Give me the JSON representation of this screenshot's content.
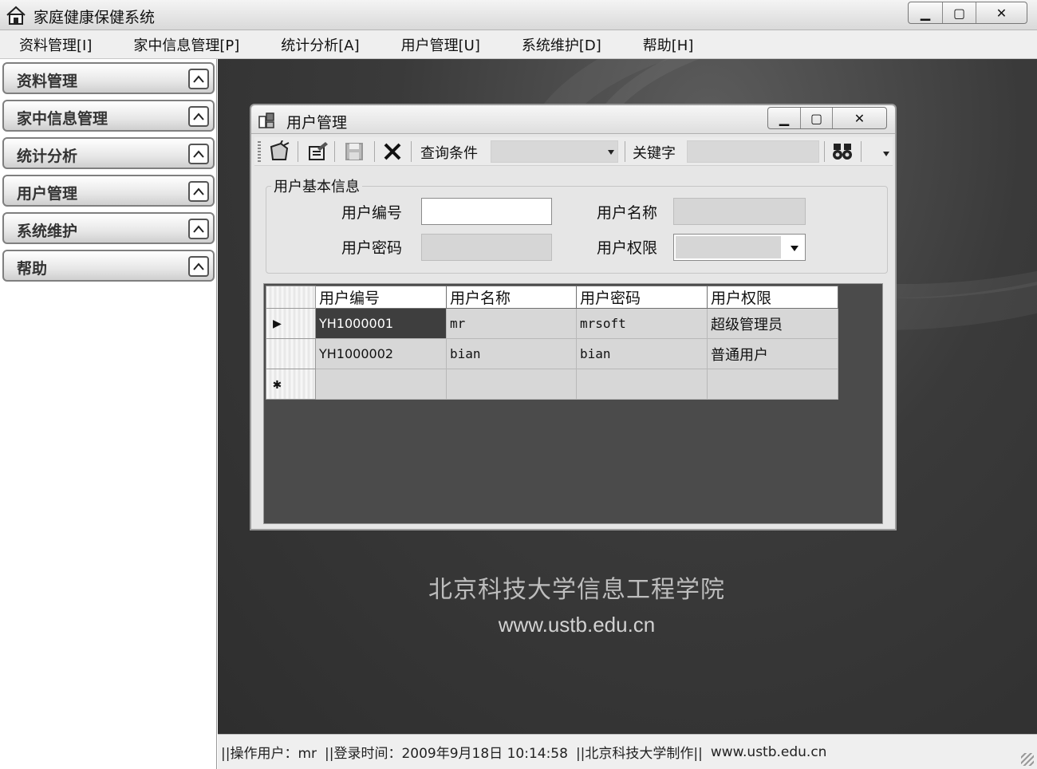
{
  "window": {
    "title": "家庭健康保健系统",
    "buttons": {
      "minimize": "▭",
      "maximize": "▢",
      "close": "✕"
    }
  },
  "menu": [
    "资料管理[I]",
    "家中信息管理[P]",
    "统计分析[A]",
    "用户管理[U]",
    "系统维护[D]",
    "帮助[H]"
  ],
  "sidebar": {
    "items": [
      {
        "label": "资料管理",
        "icon": "chevron-up-icon"
      },
      {
        "label": "家中信息管理",
        "icon": "chevron-up-icon"
      },
      {
        "label": "统计分析",
        "icon": "chevron-up-icon"
      },
      {
        "label": "用户管理",
        "icon": "chevron-up-icon"
      },
      {
        "label": "系统维护",
        "icon": "chevron-up-icon"
      },
      {
        "label": "帮助",
        "icon": "chevron-up-icon"
      }
    ]
  },
  "child_window": {
    "title": "用户管理",
    "toolbar": {
      "query_label": "查询条件",
      "query_value": "",
      "keyword_label": "关键字",
      "keyword_value": "",
      "icons": [
        "add-icon",
        "edit-icon",
        "save-icon",
        "delete-icon",
        "search-binoculars-icon"
      ]
    },
    "form": {
      "group_title": "用户基本信息",
      "user_id_label": "用户编号",
      "user_id_value": "",
      "user_name_label": "用户名称",
      "user_name_value": "",
      "password_label": "用户密码",
      "password_value": "",
      "permission_label": "用户权限",
      "permission_value": ""
    },
    "grid": {
      "columns": [
        "用户编号",
        "用户名称",
        "用户密码",
        "用户权限"
      ],
      "rows": [
        {
          "marker": "▶",
          "cells": [
            "YH1000001",
            "mr",
            "mrsoft",
            "超级管理员"
          ]
        },
        {
          "marker": "",
          "cells": [
            "YH1000002",
            "bian",
            "bian",
            "普通用户"
          ]
        }
      ],
      "new_row_marker": "✱"
    }
  },
  "branding": {
    "name": "北京科技大学信息工程学院",
    "url": "www.ustb.edu.cn"
  },
  "statusbar": {
    "operator": "||操作用户：mr",
    "login_time": "||登录时间：2009年9月18日 10:14:58",
    "maker": "||北京科技大学制作||",
    "url": "www.ustb.edu.cn"
  },
  "colors": {
    "workspace_bg": "#3a3a3a",
    "selected_cell": "#3e3e3e",
    "grid_bg": "#4b4b4b"
  }
}
